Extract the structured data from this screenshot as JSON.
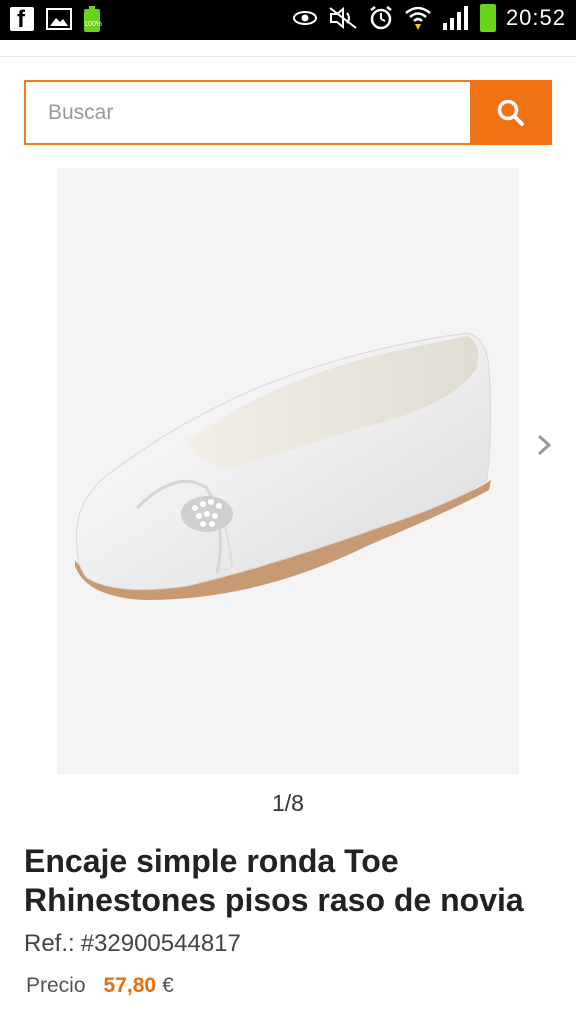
{
  "status_bar": {
    "time": "20:52",
    "battery_small_label": "100%",
    "icons": [
      "facebook-icon",
      "gallery-icon",
      "battery-icon",
      "eye-icon",
      "mute-icon",
      "alarm-icon",
      "wifi-icon",
      "signal-icon",
      "battery-icon"
    ]
  },
  "search": {
    "placeholder": "Buscar",
    "button_icon": "search-icon"
  },
  "gallery": {
    "pager": "1/8",
    "next_icon": "chevron-right-icon"
  },
  "product": {
    "title": "Encaje simple ronda Toe Rhinestones pisos raso de novia",
    "ref_label": "Ref.:",
    "ref_value": "#32900544817",
    "price_label": "Precio",
    "price_value": "57,80",
    "currency": "€"
  },
  "colors": {
    "accent": "#ef7314",
    "price": "#e66d10"
  }
}
